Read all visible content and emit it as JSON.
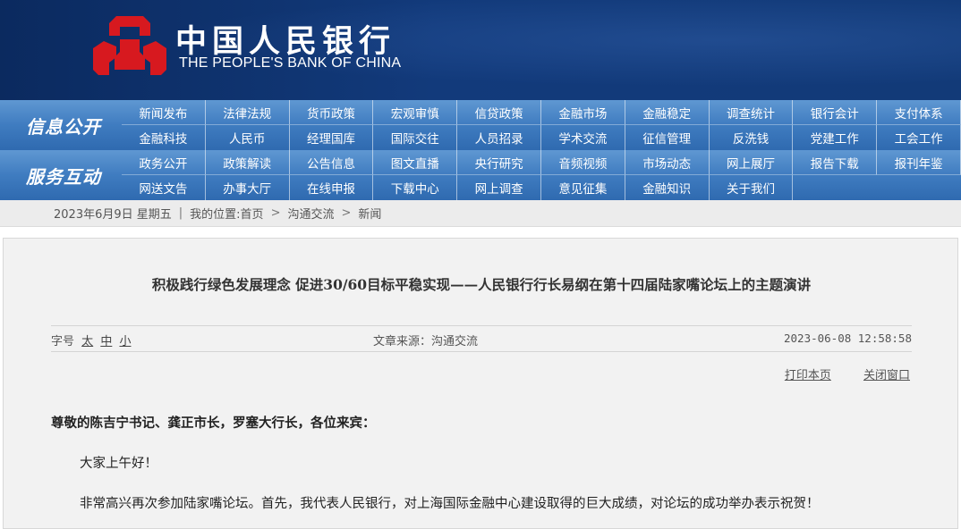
{
  "header": {
    "logo_cn": "中国人民银行",
    "logo_en": "THE PEOPLE'S BANK OF CHINA",
    "brand_color": "#d7191f",
    "bg_color": "#123a7b"
  },
  "nav": {
    "info_title": "信息公开",
    "info_items": [
      "新闻发布",
      "法律法规",
      "货币政策",
      "宏观审慎",
      "信贷政策",
      "金融市场",
      "金融稳定",
      "调查统计",
      "银行会计",
      "支付体系",
      "金融科技",
      "人民币",
      "经理国库",
      "国际交往",
      "人员招录",
      "学术交流",
      "征信管理",
      "反洗钱",
      "党建工作",
      "工会工作"
    ],
    "service_title": "服务互动",
    "service_items": [
      "政务公开",
      "政策解读",
      "公告信息",
      "图文直播",
      "央行研究",
      "音频视频",
      "市场动态",
      "网上展厅",
      "报告下载",
      "报刊年鉴",
      "网送文告",
      "办事大厅",
      "在线申报",
      "下载中心",
      "网上调查",
      "意见征集",
      "金融知识",
      "关于我们"
    ]
  },
  "breadcrumb": {
    "date": "2023年6月9日 星期五",
    "location_label": "我的位置:",
    "crumbs": [
      "首页",
      "沟通交流",
      "新闻"
    ]
  },
  "article": {
    "title": "积极践行绿色发展理念 促进30/60目标平稳实现——人民银行行长易纲在第十四届陆家嘴论坛上的主题演讲",
    "font_size_label": "字号",
    "font_sizes": [
      "太",
      "中",
      "小"
    ],
    "source": "文章来源：沟通交流",
    "date": "2023-06-08 12:58:58",
    "print_label": "打印本页",
    "close_label": "关闭窗口",
    "salutation": "尊敬的陈吉宁书记、龚正市长，罗塞大行长，各位来宾：",
    "paragraphs": [
      "大家上午好！",
      "非常高兴再次参加陆家嘴论坛。首先，我代表人民银行，对上海国际金融中心建设取得的巨大成绩，对论坛的成功举办表示祝贺！"
    ]
  }
}
